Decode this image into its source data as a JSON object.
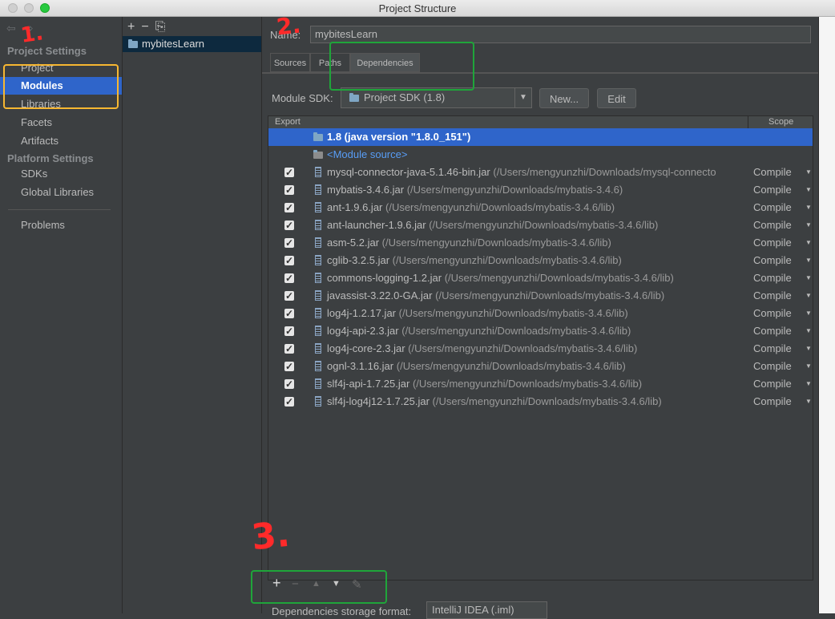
{
  "window": {
    "title": "Project Structure"
  },
  "sidebar": {
    "project_settings": "Project Settings",
    "platform_settings": "Platform Settings",
    "items": [
      {
        "label": "Project"
      },
      {
        "label": "Modules"
      },
      {
        "label": "Libraries"
      },
      {
        "label": "Facets"
      },
      {
        "label": "Artifacts"
      },
      {
        "label": "SDKs"
      },
      {
        "label": "Global Libraries"
      },
      {
        "label": "Problems"
      }
    ]
  },
  "modules": {
    "items": [
      "mybitesLearn"
    ]
  },
  "main": {
    "name_label": "Name:",
    "name_value": "mybitesLearn",
    "tabs": [
      "Sources",
      "Paths",
      "Dependencies"
    ],
    "sdk_label": "Module SDK:",
    "sdk_value": "Project SDK (1.8)",
    "new_button": "New...",
    "edit_button": "Edit",
    "table": {
      "headers": {
        "export": "Export",
        "scope": "Scope"
      },
      "rows": [
        {
          "name": "1.8 (java version \"1.8.0_151\")",
          "path": "",
          "scope": ""
        },
        {
          "name": "<Module source>",
          "path": "",
          "scope": ""
        },
        {
          "name": "mysql-connector-java-5.1.46-bin.jar",
          "path": "(/Users/mengyunzhi/Downloads/mysql-connecto",
          "scope": "Compile"
        },
        {
          "name": "mybatis-3.4.6.jar",
          "path": "(/Users/mengyunzhi/Downloads/mybatis-3.4.6)",
          "scope": "Compile"
        },
        {
          "name": "ant-1.9.6.jar",
          "path": "(/Users/mengyunzhi/Downloads/mybatis-3.4.6/lib)",
          "scope": "Compile"
        },
        {
          "name": "ant-launcher-1.9.6.jar",
          "path": "(/Users/mengyunzhi/Downloads/mybatis-3.4.6/lib)",
          "scope": "Compile"
        },
        {
          "name": "asm-5.2.jar",
          "path": "(/Users/mengyunzhi/Downloads/mybatis-3.4.6/lib)",
          "scope": "Compile"
        },
        {
          "name": "cglib-3.2.5.jar",
          "path": "(/Users/mengyunzhi/Downloads/mybatis-3.4.6/lib)",
          "scope": "Compile"
        },
        {
          "name": "commons-logging-1.2.jar",
          "path": "(/Users/mengyunzhi/Downloads/mybatis-3.4.6/lib)",
          "scope": "Compile"
        },
        {
          "name": "javassist-3.22.0-GA.jar",
          "path": "(/Users/mengyunzhi/Downloads/mybatis-3.4.6/lib)",
          "scope": "Compile"
        },
        {
          "name": "log4j-1.2.17.jar",
          "path": "(/Users/mengyunzhi/Downloads/mybatis-3.4.6/lib)",
          "scope": "Compile"
        },
        {
          "name": "log4j-api-2.3.jar",
          "path": "(/Users/mengyunzhi/Downloads/mybatis-3.4.6/lib)",
          "scope": "Compile"
        },
        {
          "name": "log4j-core-2.3.jar",
          "path": "(/Users/mengyunzhi/Downloads/mybatis-3.4.6/lib)",
          "scope": "Compile"
        },
        {
          "name": "ognl-3.1.16.jar",
          "path": "(/Users/mengyunzhi/Downloads/mybatis-3.4.6/lib)",
          "scope": "Compile"
        },
        {
          "name": "slf4j-api-1.7.25.jar",
          "path": "(/Users/mengyunzhi/Downloads/mybatis-3.4.6/lib)",
          "scope": "Compile"
        },
        {
          "name": "slf4j-log4j12-1.7.25.jar",
          "path": "(/Users/mengyunzhi/Downloads/mybatis-3.4.6/lib)",
          "scope": "Compile"
        }
      ]
    },
    "toolbar": {
      "add": "+",
      "remove": "−",
      "up": "▲",
      "down": "▼",
      "edit": "✎"
    },
    "storage_label": "Dependencies storage format:",
    "storage_value": "IntelliJ IDEA (.iml)"
  },
  "annotations": {
    "one": "1.",
    "two": "2.",
    "three": "3."
  },
  "colors": {
    "selection": "#2f65ca",
    "annotation_red": "#ff2a2a",
    "annotation_yellow": "#f7b731",
    "annotation_green": "#1fa53a"
  }
}
